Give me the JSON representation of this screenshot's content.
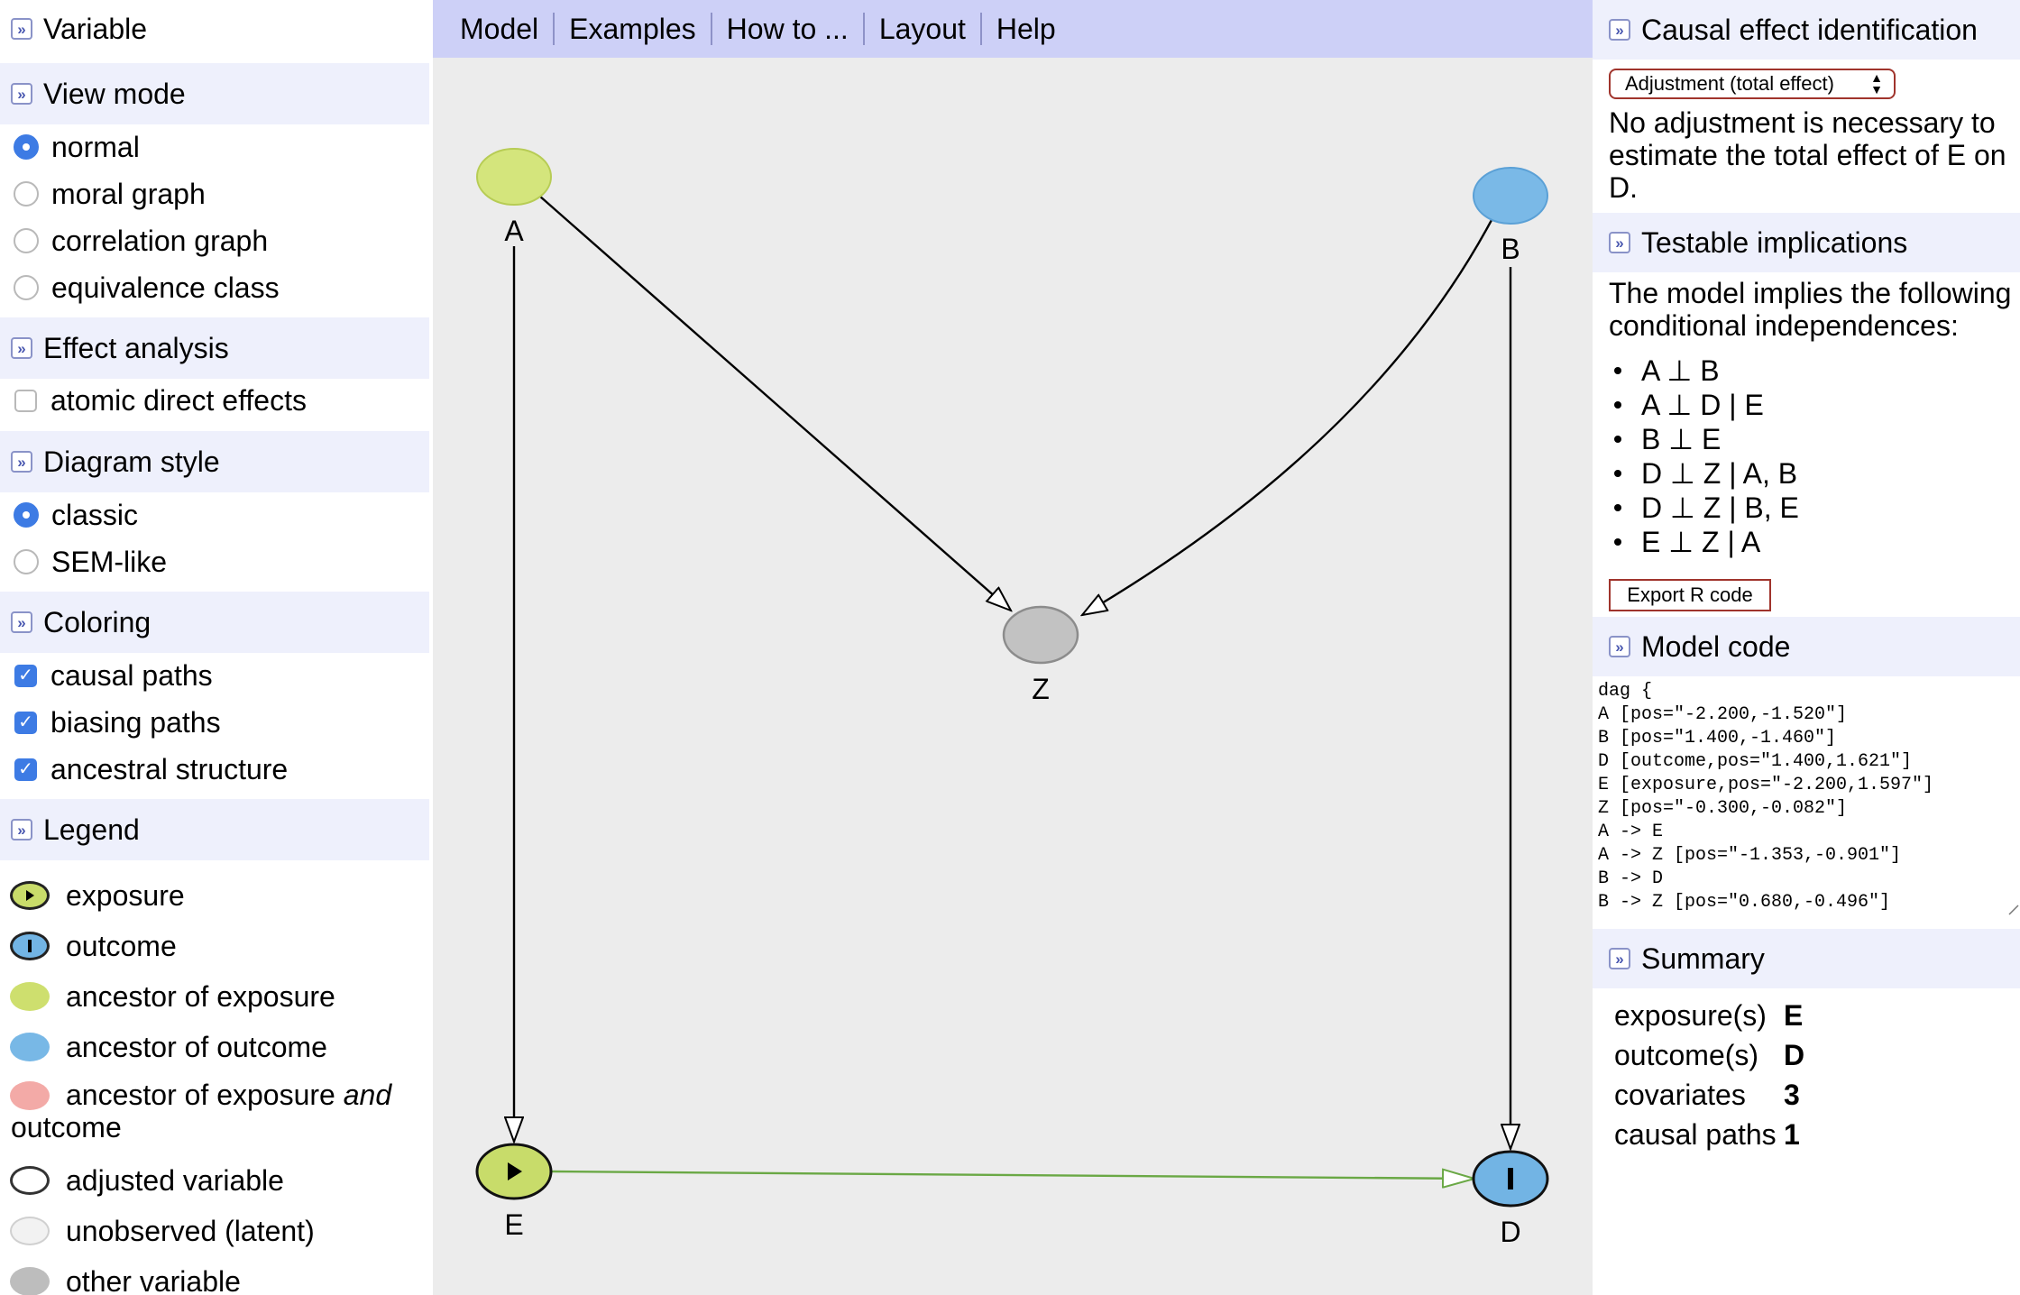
{
  "left_panel": {
    "variable_header": "Variable",
    "view_mode": {
      "header": "View mode",
      "options": [
        "normal",
        "moral graph",
        "correlation graph",
        "equivalence class"
      ],
      "selected": "normal"
    },
    "effect_analysis": {
      "header": "Effect analysis",
      "options": [
        {
          "label": "atomic direct effects",
          "checked": false
        }
      ]
    },
    "diagram_style": {
      "header": "Diagram style",
      "options": [
        "classic",
        "SEM-like"
      ],
      "selected": "classic"
    },
    "coloring": {
      "header": "Coloring",
      "options": [
        {
          "label": "causal paths",
          "checked": true
        },
        {
          "label": "biasing paths",
          "checked": true
        },
        {
          "label": "ancestral structure",
          "checked": true
        }
      ]
    },
    "legend": {
      "header": "Legend",
      "items": [
        {
          "label": "exposure",
          "color": "#c9dc6a",
          "icon": "exposure-play-icon"
        },
        {
          "label": "outcome",
          "color": "#72b4e4",
          "icon": "outcome-bar-icon"
        },
        {
          "label": "ancestor of exposure",
          "color": "#cedf6e"
        },
        {
          "label": "ancestor of outcome",
          "color": "#78b8e6"
        },
        {
          "label": "adjusted variable",
          "color": "#ffffff"
        },
        {
          "label": "unobserved (latent)",
          "color": "#f2f2f2"
        },
        {
          "label": "other variable",
          "color": "#bdbdbd"
        }
      ],
      "both": {
        "prefix": "ancestor of exposure ",
        "emph": "and",
        "suffix": "outcome",
        "color": "#f3aaa7"
      }
    }
  },
  "menu": {
    "items": [
      "Model",
      "Examples",
      "How to ...",
      "Layout",
      "Help"
    ]
  },
  "graph": {
    "nodes": {
      "A": "A",
      "B": "B",
      "Z": "Z",
      "E": "E",
      "D": "D"
    },
    "colors": {
      "exposure": "#c8dc6a",
      "ancestor_exposure": "#d4e57c",
      "outcome": "#72b4e4",
      "ancestor_outcome": "#7ab9e7",
      "other": "#c2c2c2",
      "causal_edge": "#6aa845"
    }
  },
  "right_panel": {
    "causal": {
      "header": "Causal effect identification",
      "select_value": "Adjustment (total effect)",
      "line1": "No adjustment is necessary to",
      "line2": "estimate the total effect of E on",
      "line3": "D."
    },
    "testable": {
      "header": "Testable implications",
      "line1": "The model implies the following",
      "line2": "conditional independences:",
      "items": [
        "A ⊥ B",
        "A ⊥ D | E",
        "B ⊥ E",
        "D ⊥ Z | A, B",
        "D ⊥ Z | B, E",
        "E ⊥ Z | A"
      ],
      "export_label": "Export R code"
    },
    "model_code": {
      "header": "Model code",
      "code": "dag {\nA [pos=\"-2.200,-1.520\"]\nB [pos=\"1.400,-1.460\"]\nD [outcome,pos=\"1.400,1.621\"]\nE [exposure,pos=\"-2.200,1.597\"]\nZ [pos=\"-0.300,-0.082\"]\nA -> E\nA -> Z [pos=\"-1.353,-0.901\"]\nB -> D\nB -> Z [pos=\"0.680,-0.496\"]"
    },
    "summary": {
      "header": "Summary",
      "rows": [
        {
          "key": "exposure(s)",
          "value": "E"
        },
        {
          "key": "outcome(s)",
          "value": "D"
        },
        {
          "key": "covariates",
          "value": "3"
        },
        {
          "key": "causal paths",
          "value": "1"
        }
      ]
    }
  }
}
